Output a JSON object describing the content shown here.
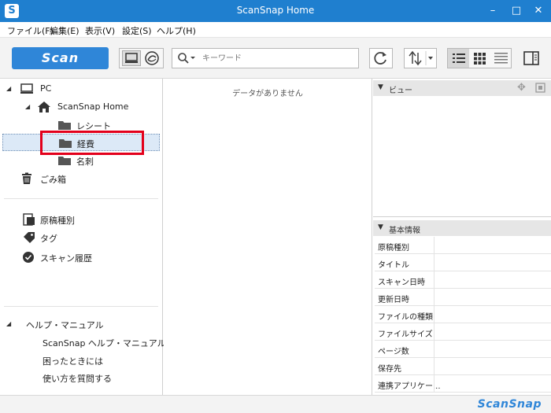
{
  "window": {
    "title": "ScanSnap Home",
    "app_icon": "S",
    "minimize": "–",
    "maximize": "□",
    "close": "✕"
  },
  "menu": [
    "ファイル(F)",
    "編集(E)",
    "表示(V)",
    "設定(S)",
    "ヘルプ(H)"
  ],
  "toolbar": {
    "scan_label": "Scan",
    "search_placeholder": "キーワード"
  },
  "tree": {
    "pc": "PC",
    "home": "ScanSnap Home",
    "folders": [
      "レシート",
      "経費",
      "名刺"
    ],
    "trash": "ごみ箱"
  },
  "filters": [
    "原稿種別",
    "タグ",
    "スキャン履歴"
  ],
  "help": {
    "header": "ヘルプ・マニュアル",
    "items": [
      "ScanSnap ヘルプ・マニュアル",
      "困ったときには",
      "使い方を質問する"
    ]
  },
  "content": {
    "empty_message": "データがありません"
  },
  "viewer": {
    "header": "ビュー"
  },
  "info": {
    "header": "基本情報",
    "fields": [
      "原稿種別",
      "タイトル",
      "スキャン日時",
      "更新日時",
      "ファイルの種類",
      "ファイルサイズ",
      "ページ数",
      "保存先",
      "連携アプリケー..."
    ]
  },
  "status": {
    "logo": "ScanSnap"
  },
  "colors": {
    "titlebar": "#1f7fcf",
    "accent": "#2f86d8",
    "highlight": "#e3001b",
    "selection": "#dce9f7"
  }
}
